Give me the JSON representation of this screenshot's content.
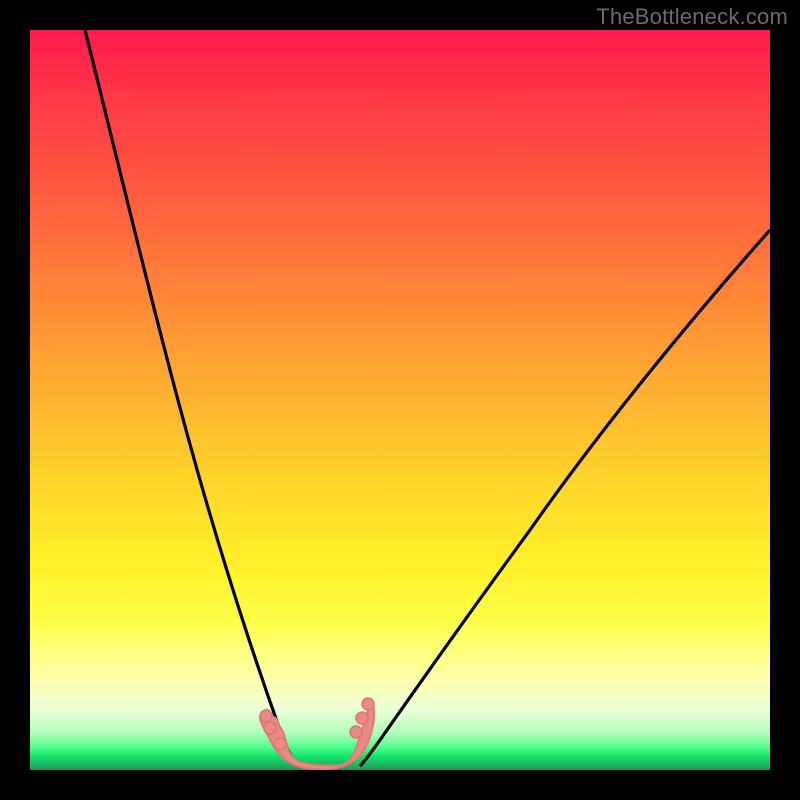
{
  "attribution": "TheBottleneck.com",
  "colors": {
    "background": "#000000",
    "curve": "#000000",
    "band_fill": "#e98b86",
    "band_stroke": "#e27a75"
  },
  "chart_data": {
    "type": "line",
    "title": "",
    "xlabel": "",
    "ylabel": "",
    "xlim": [
      0,
      100
    ],
    "ylim": [
      0,
      100
    ],
    "series": [
      {
        "name": "left-curve",
        "x": [
          8,
          10,
          12,
          14,
          16,
          18,
          20,
          22,
          24,
          26,
          28,
          30,
          32,
          33
        ],
        "y": [
          100,
          88,
          77,
          67,
          58,
          50,
          42,
          35,
          28,
          22,
          16,
          11,
          6,
          3
        ]
      },
      {
        "name": "right-curve",
        "x": [
          42,
          44,
          46,
          50,
          55,
          60,
          65,
          70,
          75,
          80,
          85,
          90,
          95,
          100
        ],
        "y": [
          3,
          6,
          9,
          14,
          21,
          28,
          34,
          40,
          46,
          52,
          57,
          62,
          67,
          72
        ]
      },
      {
        "name": "bottom-band",
        "x": [
          30,
          31,
          32,
          33,
          34,
          36,
          38,
          40,
          41,
          42,
          43,
          44
        ],
        "y": [
          7,
          5,
          3,
          2,
          1.5,
          1.2,
          1.2,
          1.5,
          2,
          3,
          5,
          7
        ]
      }
    ],
    "annotations": []
  }
}
